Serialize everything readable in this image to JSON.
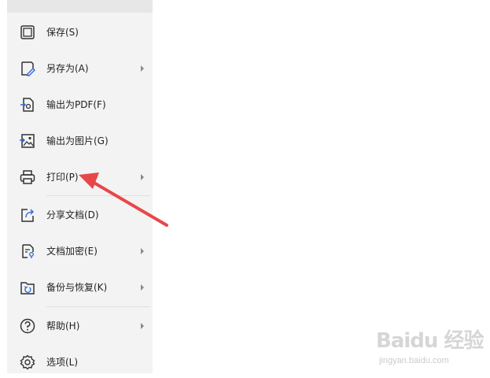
{
  "menu": {
    "items": [
      {
        "label": "保存(S)",
        "icon": "save-icon",
        "has_submenu": false
      },
      {
        "label": "另存为(A)",
        "icon": "save-as-icon",
        "has_submenu": true
      },
      {
        "label": "输出为PDF(F)",
        "icon": "export-pdf-icon",
        "has_submenu": false
      },
      {
        "label": "输出为图片(G)",
        "icon": "export-image-icon",
        "has_submenu": false
      },
      {
        "label": "打印(P)",
        "icon": "printer-icon",
        "has_submenu": true
      },
      {
        "label": "分享文档(D)",
        "icon": "share-icon",
        "has_submenu": false
      },
      {
        "label": "文档加密(E)",
        "icon": "encrypt-document-icon",
        "has_submenu": true
      },
      {
        "label": "备份与恢复(K)",
        "icon": "backup-restore-icon",
        "has_submenu": true
      },
      {
        "label": "帮助(H)",
        "icon": "help-icon",
        "has_submenu": true
      },
      {
        "label": "选项(L)",
        "icon": "gear-icon",
        "has_submenu": false
      }
    ]
  },
  "annotation": {
    "color": "#e8474a",
    "icon": "red-pointer-arrow"
  },
  "watermark": {
    "logo": "Baidu 经验",
    "url": "jingyan.baidu.com"
  }
}
